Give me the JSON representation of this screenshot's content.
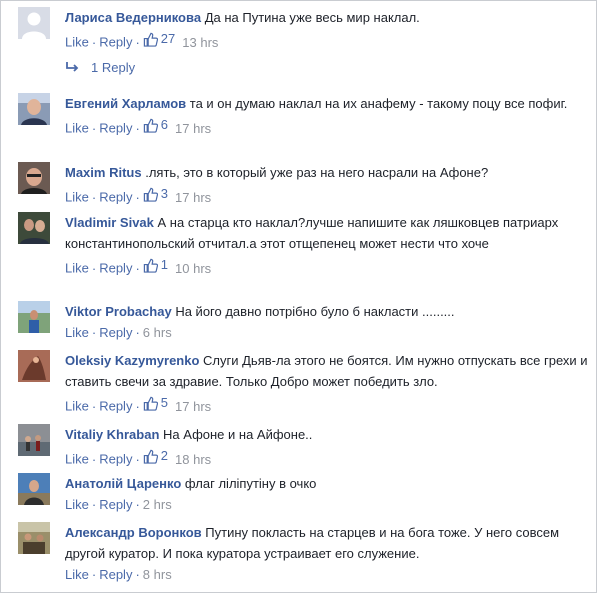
{
  "comments": [
    {
      "author": "Лариса Ведерникова",
      "text": "Да на Путина уже весь мир наклал.",
      "likes": "27",
      "time": "13 hrs",
      "replies": "1 Reply",
      "avatar": "default-avatar-icon"
    },
    {
      "author": "Евгений Харламов",
      "text": "та и он думаю наклал на их анафему - такому поцу все пофиг.",
      "likes": "6",
      "time": "17 hrs",
      "avatar": "profile-photo"
    },
    {
      "author": "Maxim Ritus",
      "text": ".лять, это в который уже раз на него насрали на Афоне?",
      "likes": "3",
      "time": "17 hrs",
      "avatar": "profile-photo"
    },
    {
      "author": "Vladimir Sivak",
      "text": "А на старца кто наклал?лучше напишите как ляшковцев патриарх константинопольский отчитал.а этот отщепенец может нести что хоче",
      "likes": "1",
      "time": "10 hrs",
      "avatar": "profile-photo"
    },
    {
      "author": "Viktor Probachay",
      "text": "На його давно потрібно було б накласти .........",
      "likes": "",
      "time": "6 hrs",
      "avatar": "profile-photo"
    },
    {
      "author": "Oleksiy Kazymyrenko",
      "text": "Слуги Дьяв-ла этого не боятся. Им нужно отпускать все грехи и ставить свечи за здравие. Только Добро может победить зло.",
      "likes": "5",
      "time": "17 hrs",
      "avatar": "profile-photo"
    },
    {
      "author": "Vitaliy Khraban",
      "text": "На Афоне и на Айфоне..",
      "likes": "2",
      "time": "18 hrs",
      "avatar": "profile-photo"
    },
    {
      "author": "Анатолій Царенко",
      "text": "флаг ліліпутіну в очко",
      "likes": "",
      "time": "2 hrs",
      "avatar": "profile-photo"
    },
    {
      "author": "Александр Воронков",
      "text": "Путину покласть на старцев и на бога тоже. У него совсем другой куратор. И пока куратора устраивает его служение.",
      "likes": "",
      "time": "8 hrs",
      "avatar": "profile-photo"
    }
  ],
  "actions": {
    "like": "Like",
    "reply": "Reply",
    "dot": "·"
  },
  "colors": {
    "link": "#365899",
    "action": "#4b6aa9",
    "meta": "#90949c",
    "text": "#1d2129"
  }
}
